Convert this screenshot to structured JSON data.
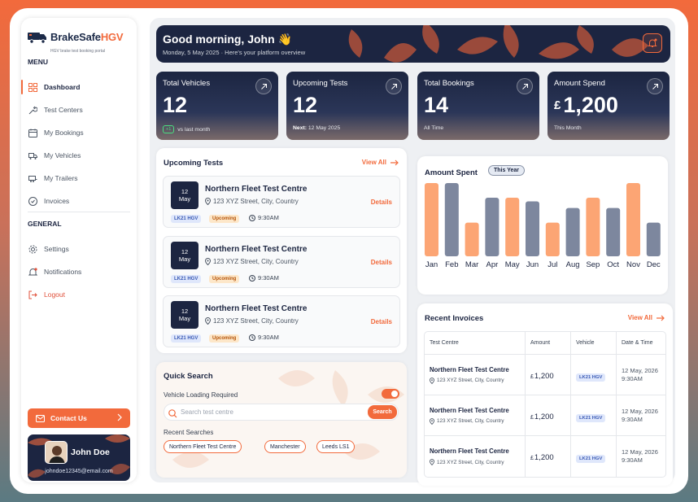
{
  "brand": {
    "name_part1": "BrakeSafe",
    "name_part2": "HGV",
    "tagline": "HGV brake test booking portal"
  },
  "sidebar": {
    "menu_label": "MENU",
    "general_label": "GENERAL",
    "items": [
      {
        "label": "Dashboard",
        "icon": "dashboard-icon",
        "active": true
      },
      {
        "label": "Test Centers",
        "icon": "wrench-icon"
      },
      {
        "label": "My Bookings",
        "icon": "calendar-icon"
      },
      {
        "label": "My Vehicles",
        "icon": "truck-icon"
      },
      {
        "label": "My Trailers",
        "icon": "trailer-icon"
      },
      {
        "label": "Invoices",
        "icon": "invoice-icon"
      }
    ],
    "general_items": [
      {
        "label": "Settings",
        "icon": "gear-icon"
      },
      {
        "label": "Notifications",
        "icon": "bell-icon"
      },
      {
        "label": "Logout",
        "icon": "logout-icon"
      }
    ],
    "contact_label": "Contact Us",
    "user": {
      "name": "John Doe",
      "email": "johndoe12345@email.com"
    }
  },
  "header": {
    "greeting": "Good morning, John 👋",
    "subtitle": "Monday, 5 May 2025 · Here's your platform overview"
  },
  "stats": [
    {
      "title": "Total Vehicles",
      "value": "12",
      "badge": "+1",
      "sub": "vs last month"
    },
    {
      "title": "Upcoming Tests",
      "value": "12",
      "sub_bold": "Next:",
      "sub": "12 May 2025"
    },
    {
      "title": "Total Bookings",
      "value": "14",
      "sub": "All Time"
    },
    {
      "title": "Amount Spend",
      "currency": "£",
      "value": "1,200",
      "sub": "This Month"
    }
  ],
  "upcoming": {
    "title": "Upcoming Tests",
    "view_all": "View All",
    "items": [
      {
        "day": "12",
        "month": "May",
        "name": "Northern Fleet Test Centre",
        "address": "123 XYZ Street, City, Country",
        "reg": "LK21 HGV",
        "status": "Upcoming",
        "time": "9:30AM",
        "details": "Details"
      },
      {
        "day": "12",
        "month": "May",
        "name": "Northern Fleet Test Centre",
        "address": "123 XYZ Street, City, Country",
        "reg": "LK21 HGV",
        "status": "Upcoming",
        "time": "9:30AM",
        "details": "Details"
      },
      {
        "day": "12",
        "month": "May",
        "name": "Northern Fleet Test Centre",
        "address": "123 XYZ Street, City, Country",
        "reg": "LK21 HGV",
        "status": "Upcoming",
        "time": "9:30AM",
        "details": "Details"
      }
    ]
  },
  "quick_search": {
    "title": "Quick Search",
    "toggle_label": "Vehicle Loading Required",
    "toggle_on": true,
    "placeholder": "Search test centre",
    "button": "Search",
    "recent_label": "Recent Searches",
    "recent": [
      "Northern Fleet Test Centre",
      "Manchester",
      "Leeds LS1"
    ]
  },
  "chart_data": {
    "type": "bar",
    "title": "Amount Spent",
    "period": "This Year",
    "categories": [
      "Jan",
      "Feb",
      "Mar",
      "Apr",
      "May",
      "Jun",
      "Jul",
      "Aug",
      "Sep",
      "Oct",
      "Nov",
      "Dec"
    ],
    "values": [
      100,
      100,
      46,
      80,
      80,
      75,
      46,
      66,
      80,
      66,
      100,
      46
    ],
    "ylim": [
      0,
      100
    ],
    "colors": [
      "#fca574",
      "#7d879e"
    ],
    "grid": false
  },
  "invoices": {
    "title": "Recent Invoices",
    "view_all": "View All",
    "columns": [
      "Test Centre",
      "Amount",
      "Vehicle",
      "Date & Time"
    ],
    "rows": [
      {
        "centre": "Northern Fleet Test Centre",
        "address": "123 XYZ Street, City, Country",
        "currency": "£",
        "amount": "1,200",
        "vehicle": "LK21 HGV",
        "date": "12 May, 2026",
        "time": "9:30AM"
      },
      {
        "centre": "Northern Fleet Test Centre",
        "address": "123 XYZ Street, City, Country",
        "currency": "£",
        "amount": "1,200",
        "vehicle": "LK21 HGV",
        "date": "12 May, 2026",
        "time": "9:30AM"
      },
      {
        "centre": "Northern Fleet Test Centre",
        "address": "123 XYZ Street, City, Country",
        "currency": "£",
        "amount": "1,200",
        "vehicle": "LK21 HGV",
        "date": "12 May, 2026",
        "time": "9:30AM"
      }
    ]
  },
  "colors": {
    "accent": "#f26a3c",
    "navy": "#1c2541"
  }
}
